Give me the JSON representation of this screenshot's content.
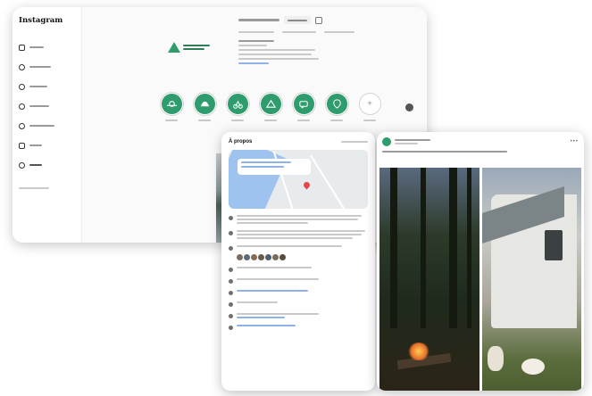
{
  "instagram": {
    "logo": "Instagram",
    "nav_icons": [
      "home-icon",
      "search-icon",
      "explore-icon",
      "messages-icon",
      "notifications-icon",
      "create-icon",
      "profile-icon"
    ],
    "highlight_icon_color": "#2e9c6c",
    "highlights": [
      {
        "icon": "sun-icon"
      },
      {
        "icon": "camping-icon"
      },
      {
        "icon": "activities-icon"
      },
      {
        "icon": "tent-icon"
      },
      {
        "icon": "trailer-icon"
      },
      {
        "icon": "region-icon"
      }
    ],
    "new_highlight_glyph": "+"
  },
  "about": {
    "title": "À propos"
  }
}
